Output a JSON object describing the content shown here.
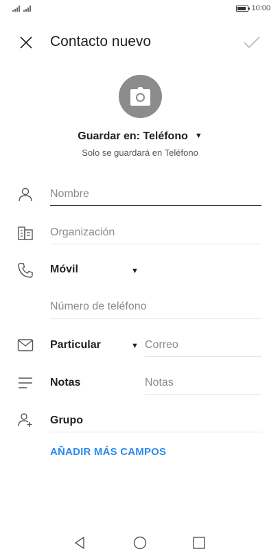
{
  "status_bar": {
    "time": "10:00"
  },
  "app_bar": {
    "title": "Contacto nuevo"
  },
  "save_location": {
    "label": "Guardar en: Teléfono",
    "note": "Solo se guardará en Teléfono"
  },
  "fields": {
    "name_placeholder": "Nombre",
    "organization_placeholder": "Organización",
    "phone_type": "Móvil",
    "phone_placeholder": "Número de teléfono",
    "email_type": "Particular",
    "email_placeholder": "Correo",
    "notes_label": "Notas",
    "notes_placeholder": "Notas",
    "group_label": "Grupo"
  },
  "add_more_label": "AÑADIR MÁS CAMPOS",
  "colors": {
    "accent": "#2d8af0",
    "avatar_bg": "#8c8c8c",
    "icon_gray": "#555555"
  }
}
